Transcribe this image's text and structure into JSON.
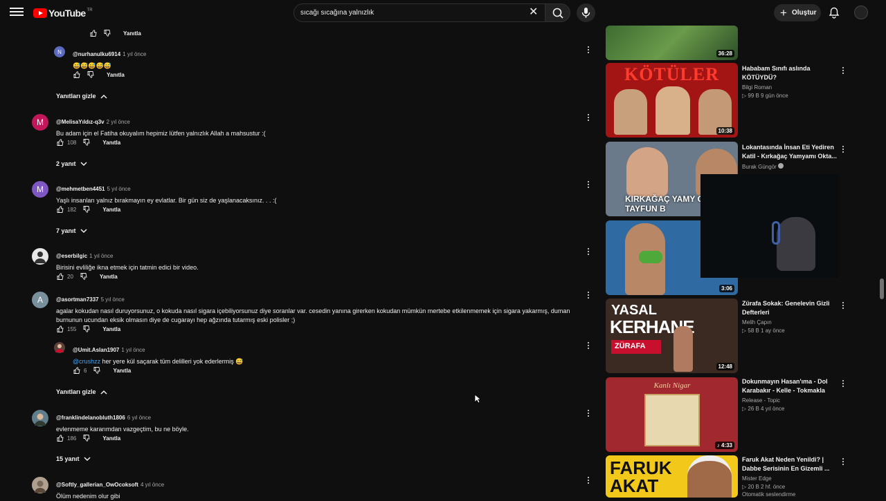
{
  "header": {
    "logo_text": "YouTube",
    "country_code": "TR",
    "search_value": "sıcağı sıcağına yalnızlık",
    "create_label": "Oluştur"
  },
  "comments": [
    {
      "type": "actions_only",
      "reply": "Yanıtla"
    },
    {
      "type": "reply",
      "handle": "@nurhanulku6914",
      "time": "1 yıl önce",
      "text": "😅😅😅😅😅",
      "likes": "",
      "reply": "Yanıtla",
      "initial": "N",
      "color": "#5c6bc0"
    },
    {
      "type": "toggle",
      "label": "Yanıtları gizle"
    },
    {
      "type": "comment",
      "handle": "@MelisaYıldız-q3v",
      "time": "2 yıl önce",
      "text": "Bu adam için el Fatiha okuyalım hepimiz lütfen yalnızlık Allah a mahsustur :(",
      "likes": "108",
      "reply": "Yanıtla",
      "initial": "M",
      "color": "#c2185b"
    },
    {
      "type": "toggle",
      "label": "2 yanıt"
    },
    {
      "type": "comment",
      "handle": "@mehmetben4451",
      "time": "5 yıl önce",
      "text": "Yaşlı insanları yalnız bırakmayın ey evlatlar.  Bir gün siz de yaşlanacaksınız. . . :(",
      "likes": "182",
      "reply": "Yanıtla",
      "initial": "M",
      "color": "#7e57c2"
    },
    {
      "type": "toggle",
      "label": "7 yanıt"
    },
    {
      "type": "comment",
      "handle": "@eserbilgic",
      "time": "1 yıl önce",
      "text": "Birisini evliliğe ikna etmek için tatmin edici bir video.",
      "likes": "20",
      "reply": "Yanıtla",
      "initial": "",
      "color": "#dddddd"
    },
    {
      "type": "comment",
      "handle": "@asortman7337",
      "time": "5 yıl önce",
      "text": "agalar kokudan nasıl duruyorsunuz, o kokuda nasıl sigara içebiliyorsunuz diye soranlar var. cesedin yanına girerken kokudan mümkün mertebe etkilenmemek için sigara yakarmış, duman burnunun ucundan eksik olmasın diye de cugarayı hep ağzında tutarmış eski polisler ;)",
      "likes": "155",
      "reply": "Yanıtla",
      "initial": "A",
      "color": "#78909c"
    },
    {
      "type": "reply",
      "handle": "@Umit.Aslan1907",
      "time": "1 yıl önce",
      "mention": "@crushzz",
      "text": "her yere kül saçarak tüm delilleri yok ederlermiş 😅",
      "likes": "6",
      "reply": "Yanıtla",
      "initial": "",
      "color": "#8d6e63"
    },
    {
      "type": "toggle",
      "label": "Yanıtları gizle"
    },
    {
      "type": "comment",
      "handle": "@franklindelanobluth1806",
      "time": "6 yıl önce",
      "text": "evlenmeme kararımdan vazgeçtim, bu ne böyle.",
      "likes": "186",
      "reply": "Yanıtla",
      "initial": "",
      "color": "#607d8b"
    },
    {
      "type": "toggle",
      "label": "15 yanıt"
    },
    {
      "type": "comment",
      "handle": "@Softly_gallerian_OwOcoksoft",
      "time": "4 yıl önce",
      "text": "Ölüm nedenim olur gibi",
      "likes": "",
      "reply": "",
      "initial": "",
      "color": "#b0a090"
    }
  ],
  "videos": [
    {
      "duration": "36:28",
      "title": "",
      "channel": "",
      "meta": ""
    },
    {
      "duration": "10:38",
      "title": "Hababam Sınıfı aslında KÖTÜYDÜ?",
      "channel": "Bilgi Roman",
      "meta": "▷ 99 B   9 gün önce",
      "thumb_text": "KÖTÜLER"
    },
    {
      "duration": "",
      "title": "Lokantasında İnsan Eti Yediren Katil - Kırkağaç Yamyamı Okta...",
      "channel": "Burak Güngör",
      "meta": "",
      "thumb_text": "KIRKAĞAÇ YAMY OKTAY TAYFUN B"
    },
    {
      "duration": "3:06",
      "title": "",
      "channel": "",
      "meta": ""
    },
    {
      "duration": "12:48",
      "title": "Zürafa Sokak: Genelevin Gizli Defterleri",
      "channel": "Melih Çapın",
      "meta": "▷ 58 B   1 ay önce",
      "thumb_text_1": "YASAL",
      "thumb_text_2": "KERHANE",
      "thumb_text_3": "ZÜRAFA"
    },
    {
      "duration": "♪ 4:33",
      "title": "Dokunmayın Hasan'ıma - Dol Karabakır - Kelle - Tokmakla",
      "channel": "Release - Topic",
      "meta": "▷ 26 B   4 yıl önce",
      "thumb_text": "Kanlı Nigar"
    },
    {
      "duration": "",
      "title": "Faruk Akat Neden Yenildi? | Dabbe Serisinin En Gizemli ...",
      "channel": "Mister Edge",
      "meta": "▷ 20 B   2 hf. önce",
      "thumb_text_1": "FARUK",
      "thumb_text_2": "AKAT",
      "autoplay": "Otomatik seslendirme"
    }
  ],
  "colors": {
    "background": "#0f0f0f",
    "accent": "#ff0000",
    "mention": "#3ea6ff"
  }
}
